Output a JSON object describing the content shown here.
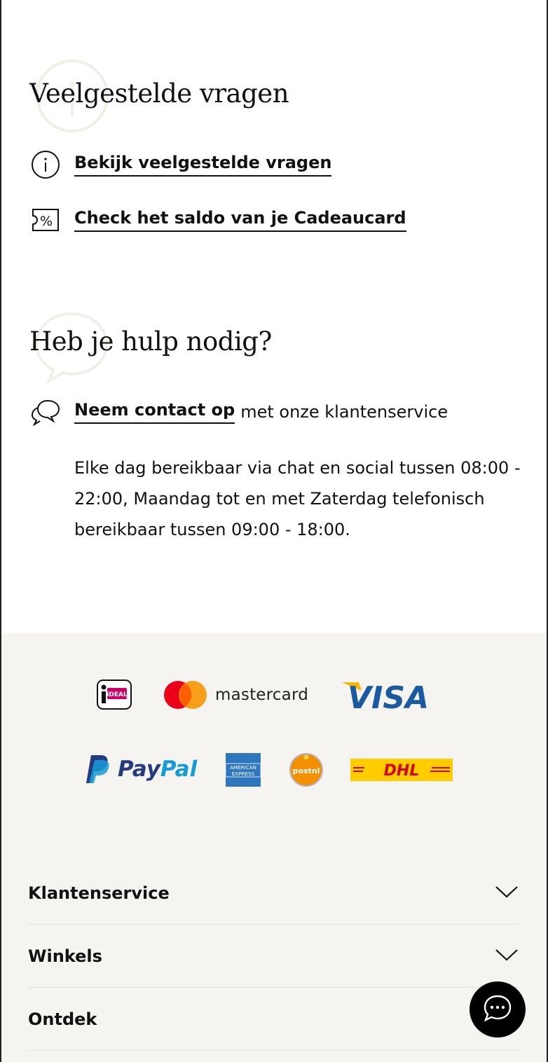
{
  "faq": {
    "title": "Veelgestelde vragen",
    "faq_link": "Bekijk veelgestelde vragen",
    "giftcard_link": "Check het saldo van je Cadeaucard"
  },
  "help": {
    "title": "Heb je hulp nodig?",
    "contact_link": "Neem contact op",
    "contact_rest": "met onze klantenservice",
    "hours": "Elke dag bereikbaar via chat en social tussen 08:00 - 22:00, Maandag tot en met Zaterdag telefonisch bereikbaar tussen 09:00 - 18:00."
  },
  "payments": {
    "ideal": "iDEAL",
    "mastercard": "mastercard",
    "visa": "VISA",
    "paypal_pay": "Pay",
    "paypal_pal": "Pal",
    "amex_1": "AMERICAN",
    "amex_2": "EXPRESS",
    "postnl": "postnl",
    "dhl": "DHL"
  },
  "accordion": [
    {
      "label": "Klantenservice"
    },
    {
      "label": "Winkels"
    },
    {
      "label": "Ontdek"
    }
  ],
  "colors": {
    "footer_bg": "#f6f4f1",
    "mastercard_red": "#eb001b",
    "mastercard_orange": "#f79e1b",
    "visa_blue": "#1a1f71",
    "paypal_dark": "#253b80",
    "paypal_light": "#179bd7",
    "amex_blue": "#2e77bc",
    "postnl_orange": "#f39000",
    "dhl_yellow": "#ffcc00",
    "dhl_red": "#d40511"
  },
  "icons": [
    "info-icon",
    "ticket-percent-icon",
    "chat-bubbles-icon",
    "chevron-down-icon",
    "chat-icon"
  ]
}
